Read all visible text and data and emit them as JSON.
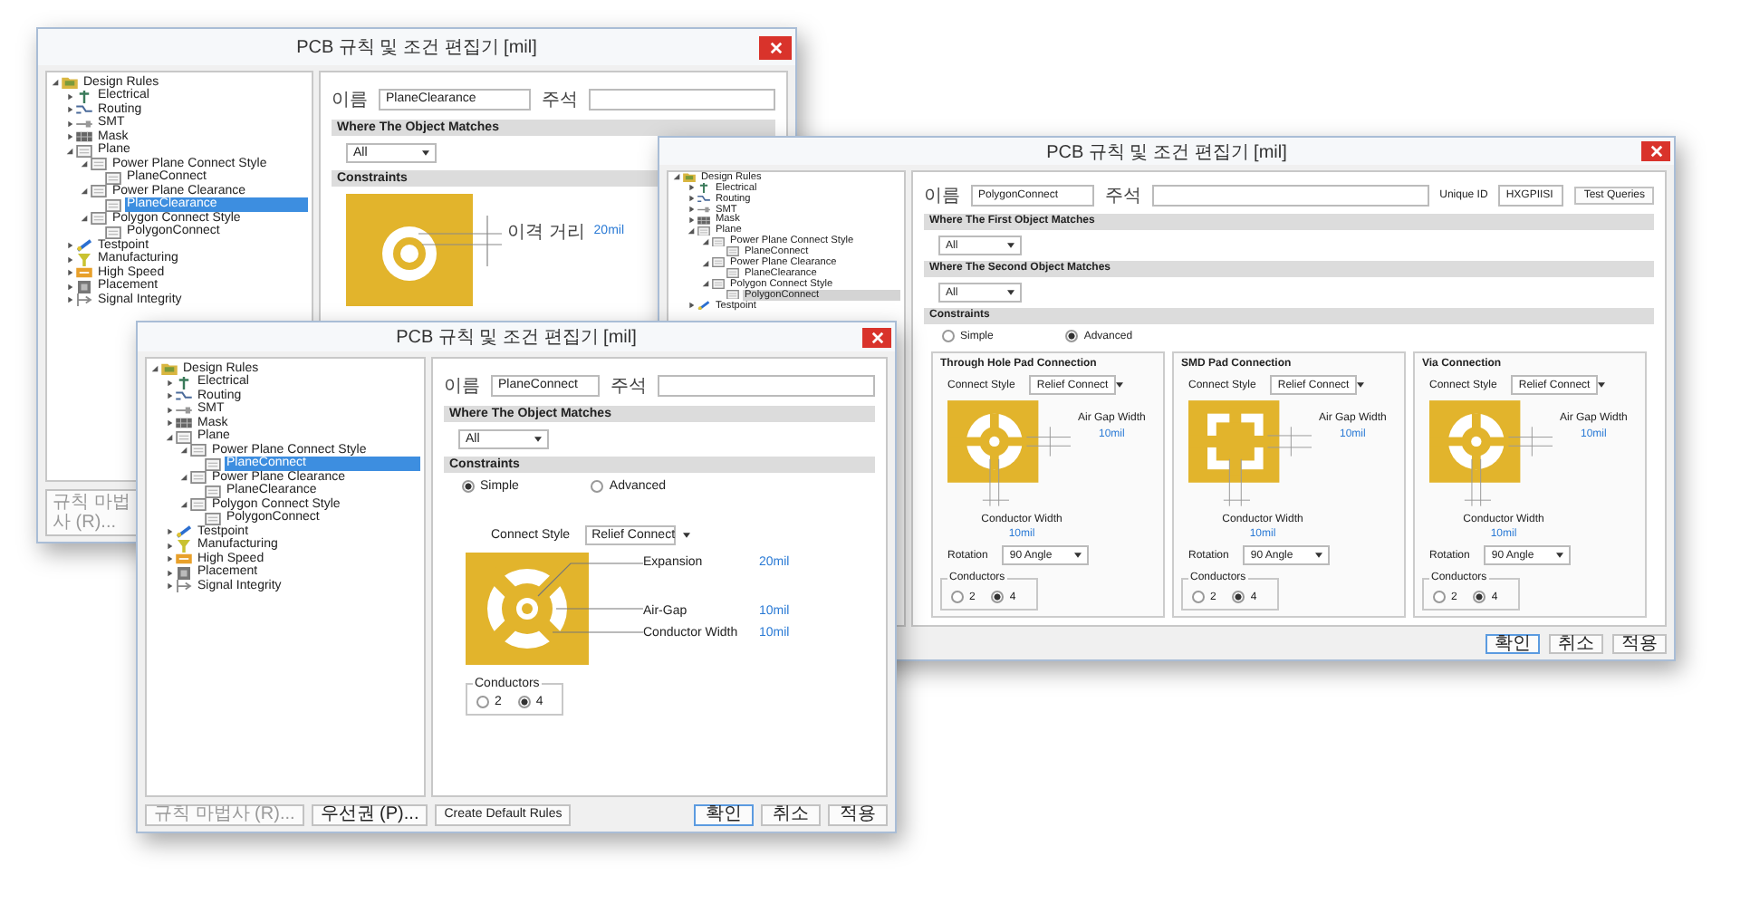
{
  "back_window": {
    "title": "PCB 규칙 및 조건 편집기 [mil]",
    "tree": [
      {
        "label": "Design Rules",
        "kind": "folder",
        "expanded": true,
        "selected": false,
        "children": [
          {
            "label": "Electrical",
            "kind": "electrical",
            "expanded": false,
            "selected": false
          },
          {
            "label": "Routing",
            "kind": "routing",
            "expanded": false,
            "selected": false
          },
          {
            "label": "SMT",
            "kind": "smt",
            "expanded": false,
            "selected": false
          },
          {
            "label": "Mask",
            "kind": "mask",
            "expanded": false,
            "selected": false
          },
          {
            "label": "Plane",
            "kind": "plane",
            "expanded": true,
            "selected": false,
            "children": [
              {
                "label": "Power Plane Connect Style",
                "kind": "plane",
                "expanded": true,
                "selected": false,
                "children": [
                  {
                    "label": "PlaneConnect",
                    "kind": "rule",
                    "selected": false
                  }
                ]
              },
              {
                "label": "Power Plane Clearance",
                "kind": "plane",
                "expanded": true,
                "selected": false,
                "children": [
                  {
                    "label": "PlaneClearance",
                    "kind": "rule",
                    "selected": true
                  }
                ]
              },
              {
                "label": "Polygon Connect Style",
                "kind": "plane",
                "expanded": true,
                "selected": false,
                "children": [
                  {
                    "label": "PolygonConnect",
                    "kind": "rule",
                    "selected": false
                  }
                ]
              }
            ]
          },
          {
            "label": "Testpoint",
            "kind": "testpoint",
            "expanded": false,
            "selected": false
          },
          {
            "label": "Manufacturing",
            "kind": "manufacturing",
            "expanded": false,
            "selected": false
          },
          {
            "label": "High Speed",
            "kind": "highspeed",
            "expanded": false,
            "selected": false
          },
          {
            "label": "Placement",
            "kind": "placement",
            "expanded": false,
            "selected": false
          },
          {
            "label": "Signal Integrity",
            "kind": "signal",
            "expanded": false,
            "selected": false
          }
        ]
      }
    ],
    "name": {
      "label": "이름",
      "value": "PlaneClearance"
    },
    "comment": {
      "label": "주석"
    },
    "match_header": "Where The Object Matches",
    "match_value": "All",
    "constraints_header": "Constraints",
    "clearance": {
      "label": "이격 거리",
      "value": "20mil"
    },
    "buttons": [
      {
        "label": "규칙 마법사 (R)...",
        "disabled": true
      }
    ]
  },
  "middle_window": {
    "title": "PCB 규칙 및 조건 편집기 [mil]",
    "tree": [
      {
        "label": "Design Rules",
        "kind": "folder",
        "expanded": true,
        "selected": false,
        "children": [
          {
            "label": "Electrical",
            "kind": "electrical",
            "expanded": false,
            "selected": false
          },
          {
            "label": "Routing",
            "kind": "routing",
            "expanded": false,
            "selected": false
          },
          {
            "label": "SMT",
            "kind": "smt",
            "expanded": false,
            "selected": false
          },
          {
            "label": "Mask",
            "kind": "mask",
            "expanded": false,
            "selected": false
          },
          {
            "label": "Plane",
            "kind": "plane",
            "expanded": true,
            "selected": false,
            "children": [
              {
                "label": "Power Plane Connect Style",
                "kind": "plane",
                "expanded": true,
                "selected": false,
                "children": [
                  {
                    "label": "PlaneConnect",
                    "kind": "rule",
                    "selected": false
                  }
                ]
              },
              {
                "label": "Power Plane Clearance",
                "kind": "plane",
                "expanded": true,
                "selected": false,
                "children": [
                  {
                    "label": "PlaneClearance",
                    "kind": "rule",
                    "selected": false
                  }
                ]
              },
              {
                "label": "Polygon Connect Style",
                "kind": "plane",
                "expanded": true,
                "selected": false,
                "children": [
                  {
                    "label": "PolygonConnect",
                    "kind": "rule",
                    "selected": true
                  }
                ]
              }
            ]
          },
          {
            "label": "Testpoint",
            "kind": "testpoint",
            "expanded": false,
            "selected": false
          }
        ]
      }
    ],
    "name": {
      "label": "이름",
      "value": "PolygonConnect"
    },
    "comment": {
      "label": "주석"
    },
    "unique_id": {
      "label": "Unique ID",
      "value": "HXGPIISI"
    },
    "test_button": "Test Queries",
    "first_match_header": "Where The First Object Matches",
    "first_match_value": "All",
    "second_match_header": "Where The Second Object Matches",
    "second_match_value": "All",
    "constraints_header": "Constraints",
    "modes": [
      {
        "label": "Simple",
        "selected": false
      },
      {
        "label": "Advanced",
        "selected": true
      }
    ],
    "panels": [
      {
        "title": "Through Hole Pad Connection",
        "kind": "round",
        "connect_style": {
          "label": "Connect Style",
          "value": "Relief Connect"
        },
        "air_gap": {
          "label": "Air Gap Width",
          "value": "10mil"
        },
        "conductor_width": {
          "label": "Conductor Width",
          "value": "10mil"
        },
        "rotation": {
          "label": "Rotation",
          "value": "90 Angle"
        },
        "conductors": {
          "label": "Conductors",
          "options": [
            {
              "label": "2",
              "selected": false
            },
            {
              "label": "4",
              "selected": true
            }
          ]
        }
      },
      {
        "title": "SMD Pad Connection",
        "kind": "square",
        "connect_style": {
          "label": "Connect Style",
          "value": "Relief Connect"
        },
        "air_gap": {
          "label": "Air Gap Width",
          "value": "10mil"
        },
        "conductor_width": {
          "label": "Conductor Width",
          "value": "10mil"
        },
        "rotation": {
          "label": "Rotation",
          "value": "90 Angle"
        },
        "conductors": {
          "label": "Conductors",
          "options": [
            {
              "label": "2",
              "selected": false
            },
            {
              "label": "4",
              "selected": true
            }
          ]
        }
      },
      {
        "title": "Via Connection",
        "kind": "round",
        "connect_style": {
          "label": "Connect Style",
          "value": "Relief Connect"
        },
        "air_gap": {
          "label": "Air Gap Width",
          "value": "10mil"
        },
        "conductor_width": {
          "label": "Conductor Width",
          "value": "10mil"
        },
        "rotation": {
          "label": "Rotation",
          "value": "90 Angle"
        },
        "conductors": {
          "label": "Conductors",
          "options": [
            {
              "label": "2",
              "selected": false
            },
            {
              "label": "4",
              "selected": true
            }
          ]
        }
      }
    ],
    "buttons": [
      {
        "label": "확인",
        "default": true
      },
      {
        "label": "취소",
        "default": false
      },
      {
        "label": "적용",
        "default": false
      }
    ]
  },
  "front_window": {
    "title": "PCB 규칙 및 조건 편집기 [mil]",
    "tree": [
      {
        "label": "Design Rules",
        "kind": "folder",
        "expanded": true,
        "selected": false,
        "children": [
          {
            "label": "Electrical",
            "kind": "electrical",
            "expanded": false,
            "selected": false
          },
          {
            "label": "Routing",
            "kind": "routing",
            "expanded": false,
            "selected": false
          },
          {
            "label": "SMT",
            "kind": "smt",
            "expanded": false,
            "selected": false
          },
          {
            "label": "Mask",
            "kind": "mask",
            "expanded": false,
            "selected": false
          },
          {
            "label": "Plane",
            "kind": "plane",
            "expanded": true,
            "selected": false,
            "children": [
              {
                "label": "Power Plane Connect Style",
                "kind": "plane",
                "expanded": true,
                "selected": false,
                "children": [
                  {
                    "label": "PlaneConnect",
                    "kind": "rule",
                    "selected": true
                  }
                ]
              },
              {
                "label": "Power Plane Clearance",
                "kind": "plane",
                "expanded": true,
                "selected": false,
                "children": [
                  {
                    "label": "PlaneClearance",
                    "kind": "rule",
                    "selected": false
                  }
                ]
              },
              {
                "label": "Polygon Connect Style",
                "kind": "plane",
                "expanded": true,
                "selected": false,
                "children": [
                  {
                    "label": "PolygonConnect",
                    "kind": "rule",
                    "selected": false
                  }
                ]
              }
            ]
          },
          {
            "label": "Testpoint",
            "kind": "testpoint",
            "expanded": false,
            "selected": false
          },
          {
            "label": "Manufacturing",
            "kind": "manufacturing",
            "expanded": false,
            "selected": false
          },
          {
            "label": "High Speed",
            "kind": "highspeed",
            "expanded": false,
            "selected": false
          },
          {
            "label": "Placement",
            "kind": "placement",
            "expanded": false,
            "selected": false
          },
          {
            "label": "Signal Integrity",
            "kind": "signal",
            "expanded": false,
            "selected": false
          }
        ]
      }
    ],
    "name": {
      "label": "이름",
      "value": "PlaneConnect"
    },
    "comment": {
      "label": "주석"
    },
    "match_header": "Where The Object Matches",
    "match_value": "All",
    "constraints_header": "Constraints",
    "modes": [
      {
        "label": "Simple",
        "selected": true
      },
      {
        "label": "Advanced",
        "selected": false
      }
    ],
    "connect_style": {
      "label": "Connect Style",
      "value": "Relief Connect"
    },
    "annotations": [
      {
        "label": "Expansion",
        "value": "20mil"
      },
      {
        "label": "Air-Gap",
        "value": "10mil"
      },
      {
        "label": "Conductor Width",
        "value": "10mil"
      }
    ],
    "conductors": {
      "label": "Conductors",
      "options": [
        {
          "label": "2",
          "selected": false
        },
        {
          "label": "4",
          "selected": true
        }
      ]
    },
    "left_buttons": [
      {
        "label": "규칙 마법사 (R)...",
        "disabled": true
      },
      {
        "label": "우선권 (P)...",
        "disabled": false
      },
      {
        "label": "Create Default Rules",
        "disabled": false
      }
    ],
    "buttons": [
      {
        "label": "확인",
        "default": true
      },
      {
        "label": "취소",
        "default": false
      },
      {
        "label": "적용",
        "default": false
      }
    ]
  }
}
